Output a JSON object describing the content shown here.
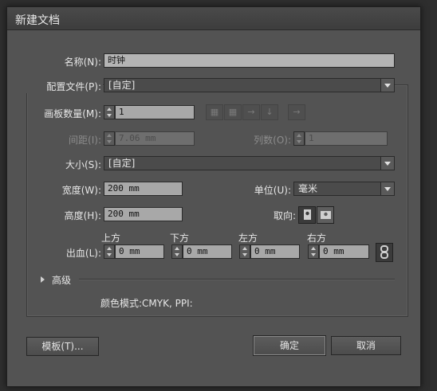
{
  "window": {
    "title": "新建文档"
  },
  "name": {
    "label": "名称(N):",
    "value": "时钟"
  },
  "profile": {
    "label": "配置文件(P):",
    "value": "[自定]"
  },
  "artboards": {
    "label": "画板数量(M):",
    "value": "1"
  },
  "spacing": {
    "label": "间距(I):",
    "value": "7.06 mm"
  },
  "columns": {
    "label": "列数(O):",
    "value": "1"
  },
  "size": {
    "label": "大小(S):",
    "value": "[自定]"
  },
  "width": {
    "label": "宽度(W):",
    "value": "200 mm"
  },
  "units": {
    "label": "单位(U):",
    "value": "毫米"
  },
  "height": {
    "label": "高度(H):",
    "value": "200 mm"
  },
  "orientation": {
    "label": "取向:"
  },
  "bleed": {
    "label": "出血(L):",
    "top": {
      "label": "上方",
      "value": "0 mm"
    },
    "bottom": {
      "label": "下方",
      "value": "0 mm"
    },
    "left": {
      "label": "左方",
      "value": "0 mm"
    },
    "right": {
      "label": "右方",
      "value": "0 mm"
    }
  },
  "advanced": {
    "label": "高级"
  },
  "color_mode": {
    "text": "颜色模式:CMYK, PPI:"
  },
  "buttons": {
    "templates": "模板(T)...",
    "ok": "确定",
    "cancel": "取消"
  },
  "icons": [
    "grid-by-row-icon",
    "grid-by-column-icon",
    "arrange-by-row-icon",
    "arrange-by-column-icon",
    "right-to-left-icon",
    "portrait-icon",
    "landscape-icon",
    "link-icon",
    "expand-triangle-icon",
    "dropdown-arrow-icon",
    "spinner-icon"
  ]
}
